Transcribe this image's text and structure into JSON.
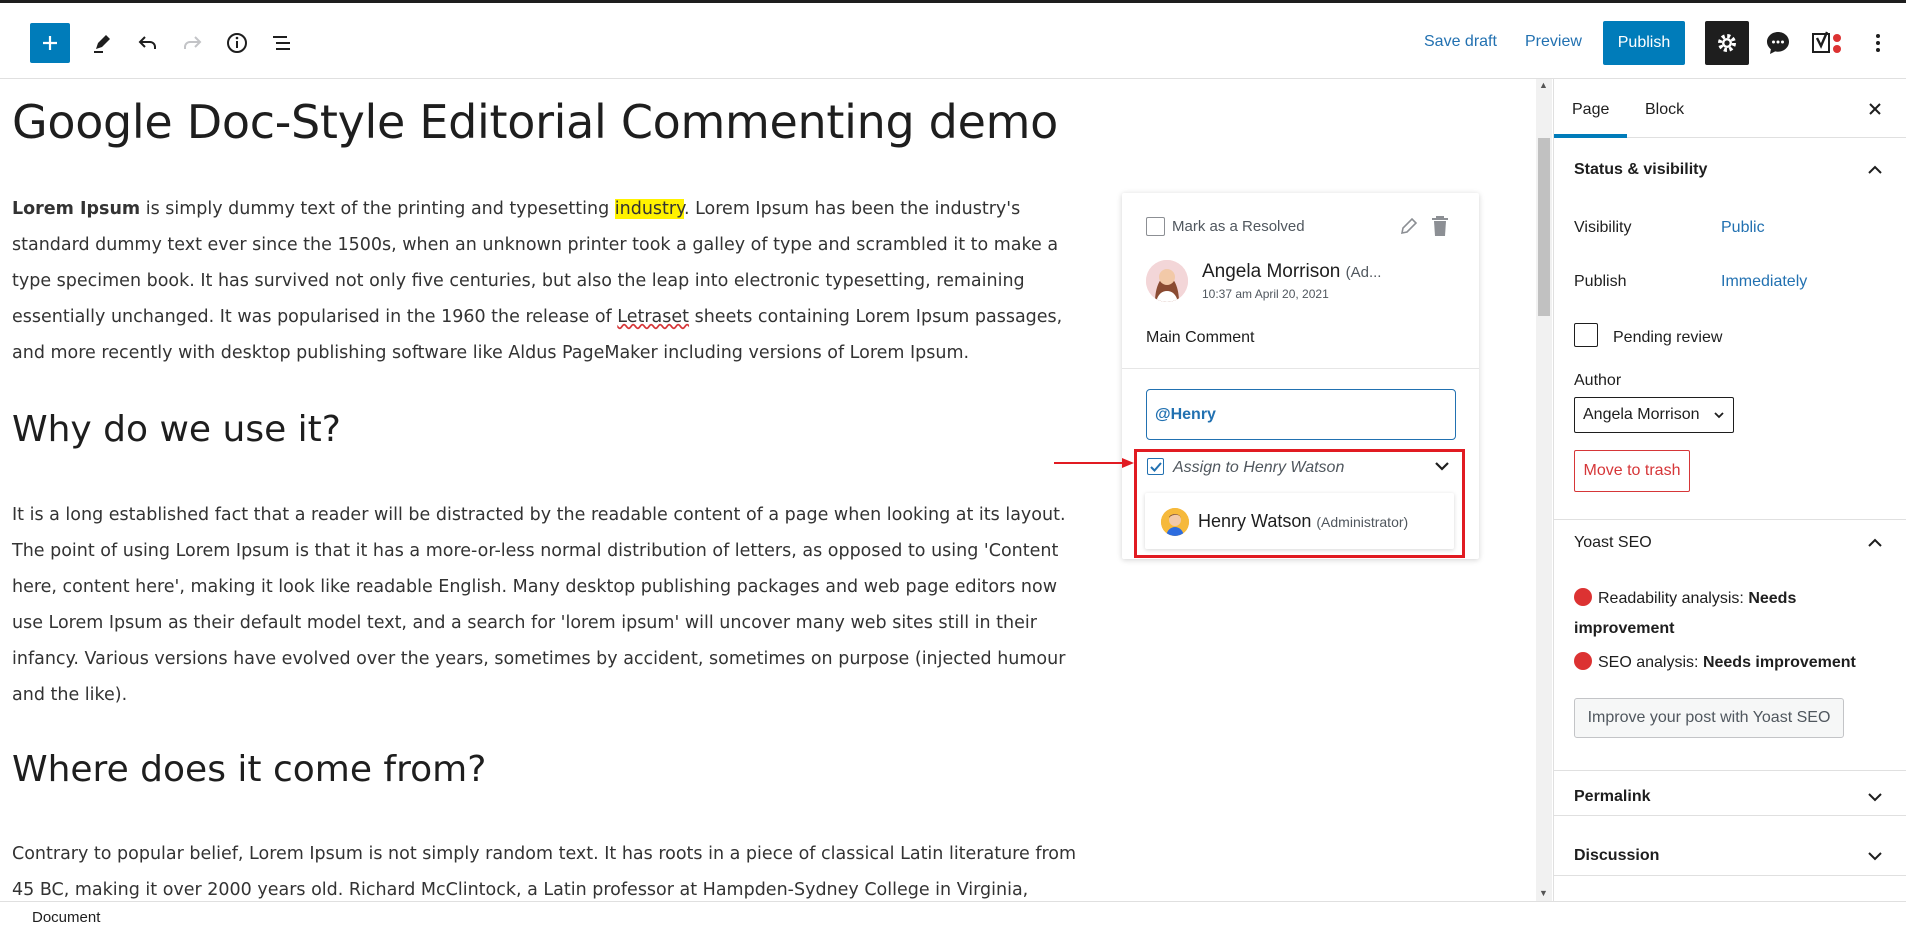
{
  "toolbar": {
    "save_draft": "Save draft",
    "preview": "Preview",
    "publish": "Publish",
    "icons": [
      "plus-icon",
      "pencil-icon",
      "undo-icon",
      "redo-icon",
      "info-icon",
      "list-view-icon",
      "gear-icon",
      "chat-icon",
      "yoast-icon",
      "more-vertical-icon"
    ],
    "accent": "#007cba"
  },
  "post": {
    "title": "Google Doc-Style Editorial Commenting demo",
    "p1": {
      "bold": "Lorem Ipsum",
      "a": " is simply dummy text of the printing and typesetting ",
      "highlight": "industry",
      "b": ". Lorem Ipsum has been the industry's standard dummy text ever since the 1500s, when an unknown printer took a galley of type and scrambled it to make a type specimen book. It has survived not only five centuries, but also the leap into electronic typesetting, remaining essentially unchanged. It was popularised in the 1960 the release of ",
      "misspelled": "Letraset",
      "c": " sheets containing Lorem Ipsum passages, and more recently with desktop publishing software like Aldus PageMaker including versions of Lorem Ipsum."
    },
    "h2_1": "Why do we use it?",
    "p2": "It is a long established fact that a reader will be distracted by the readable content of a page when looking at its layout. The point of using Lorem Ipsum is that it has a more-or-less normal distribution of letters, as opposed to using 'Content here, content here', making it look like readable English. Many desktop publishing packages and web page editors now use Lorem Ipsum as their default model text, and a search for 'lorem ipsum' will uncover many web sites still in their infancy. Various versions have evolved over the years, sometimes by accident, sometimes on purpose (injected humour and the like).",
    "h2_2": "Where does it come from?",
    "p3": "Contrary to popular belief, Lorem Ipsum is not simply random text. It has roots in a piece of classical Latin literature from 45 BC, making it over 2000 years old. Richard McClintock, a Latin professor at Hampden-Sydney College in Virginia,"
  },
  "comment": {
    "resolve_label": "Mark as a Resolved",
    "author_name": "Angela Morrison",
    "author_role": "(Ad...",
    "timestamp": "10:37 am April 20, 2021",
    "text": "Main Comment",
    "reply_value": "@Henry",
    "assign_label": "Assign to Henry Watson",
    "assign_checked": true,
    "suggestion_name": "Henry Watson",
    "suggestion_role": "(Administrator)",
    "highlight_color": "#e11b22"
  },
  "sidebar": {
    "tab_page": "Page",
    "tab_block": "Block",
    "status_title": "Status & visibility",
    "visibility_label": "Visibility",
    "visibility_value": "Public",
    "publish_label": "Publish",
    "publish_value": "Immediately",
    "pending_label": "Pending review",
    "author_label": "Author",
    "author_value": "Angela Morrison",
    "trash_label": "Move to trash",
    "yoast_title": "Yoast SEO",
    "readability_label": "Readability analysis:",
    "readability_value": "Needs",
    "readability_value2": "improvement",
    "seo_label": "SEO analysis:",
    "seo_value": "Needs improvement",
    "yoast_button": "Improve your post with Yoast SEO",
    "permalink_title": "Permalink",
    "discussion_title": "Discussion"
  },
  "footer": {
    "breadcrumb": "Document"
  }
}
